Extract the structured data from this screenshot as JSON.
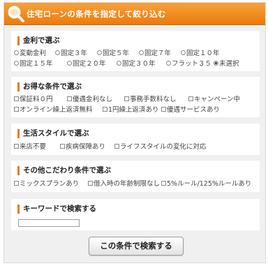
{
  "header": {
    "title": "住宅ローンの条件を指定して絞り込む",
    "icon": "search-icon",
    "colors": {
      "start": "#f7a23a",
      "end": "#ec7a0c",
      "accent": "#ea7a12"
    }
  },
  "sections": {
    "interest": {
      "title": "金利で選ぶ",
      "options": [
        {
          "label": "変動金利",
          "checked": false
        },
        {
          "label": "固定３年",
          "checked": false
        },
        {
          "label": "固定５年",
          "checked": false
        },
        {
          "label": "固定７年",
          "checked": false
        },
        {
          "label": "固定１０年",
          "checked": false
        },
        {
          "label": "固定１５年",
          "checked": false
        },
        {
          "label": "固定２０年",
          "checked": false
        },
        {
          "label": "固定３０年",
          "checked": false
        },
        {
          "label": "フラット３５",
          "checked": false
        },
        {
          "label": "未選択",
          "checked": true
        }
      ]
    },
    "benefits": {
      "title": "お得な条件で選ぶ",
      "options": [
        {
          "label": "保証料０円",
          "checked": false
        },
        {
          "label": "優遇金利なし",
          "checked": false
        },
        {
          "label": "事務手数料なし",
          "checked": false
        },
        {
          "label": "キャンペーン中",
          "checked": false
        },
        {
          "label": "オンライン繰上返済無料",
          "checked": false
        },
        {
          "label": "1円繰上返済あり",
          "checked": false
        },
        {
          "label": "優遇サービスあり",
          "checked": false
        }
      ]
    },
    "lifestyle": {
      "title": "生活スタイルで選ぶ",
      "options": [
        {
          "label": "来店不要",
          "checked": false
        },
        {
          "label": "疾病保障あり",
          "checked": false
        },
        {
          "label": "ライフスタイルの変化に対応",
          "checked": false
        }
      ]
    },
    "other": {
      "title": "その他こだわり条件で選ぶ",
      "options": [
        {
          "label": "ミックスプランあり",
          "checked": false
        },
        {
          "label": "借入時の年齢制限なし",
          "checked": false
        },
        {
          "label": "5%ルール/125%ルールあり",
          "checked": false
        }
      ]
    },
    "keyword": {
      "title": "キーワードで検索する",
      "value": "",
      "placeholder": ""
    }
  },
  "search_button": {
    "label": "この条件で検索する"
  }
}
